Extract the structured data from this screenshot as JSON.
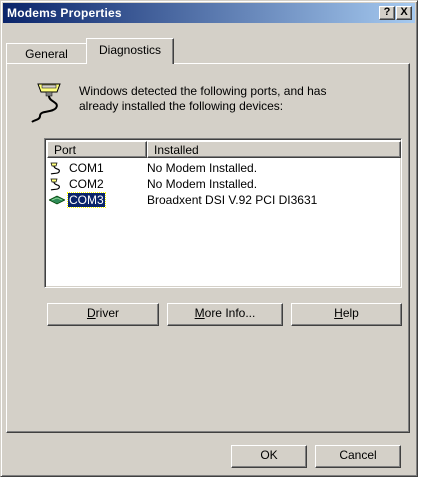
{
  "window": {
    "title": "Modems Properties"
  },
  "titlebar_buttons": {
    "help": "?",
    "close": "X"
  },
  "tabs": [
    {
      "label": "General"
    },
    {
      "label": "Diagnostics"
    }
  ],
  "info": {
    "line1": "Windows detected the following ports, and has",
    "line2": "already installed the following devices:"
  },
  "list": {
    "columns": [
      "Port",
      "Installed"
    ],
    "rows": [
      {
        "port": "COM1",
        "installed": "No Modem Installed.",
        "icon": "serial-port-icon"
      },
      {
        "port": "COM2",
        "installed": "No Modem Installed.",
        "icon": "serial-port-icon"
      },
      {
        "port": "COM3",
        "installed": "Broadxent DSI V.92 PCI DI3631",
        "icon": "modem-icon",
        "selected": true
      }
    ]
  },
  "buttons": {
    "driver_mnemonic": "D",
    "driver_rest": "river",
    "more_mnemonic": "M",
    "more_rest": "ore Info...",
    "help_mnemonic": "H",
    "help_rest": "elp",
    "ok": "OK",
    "cancel": "Cancel"
  }
}
